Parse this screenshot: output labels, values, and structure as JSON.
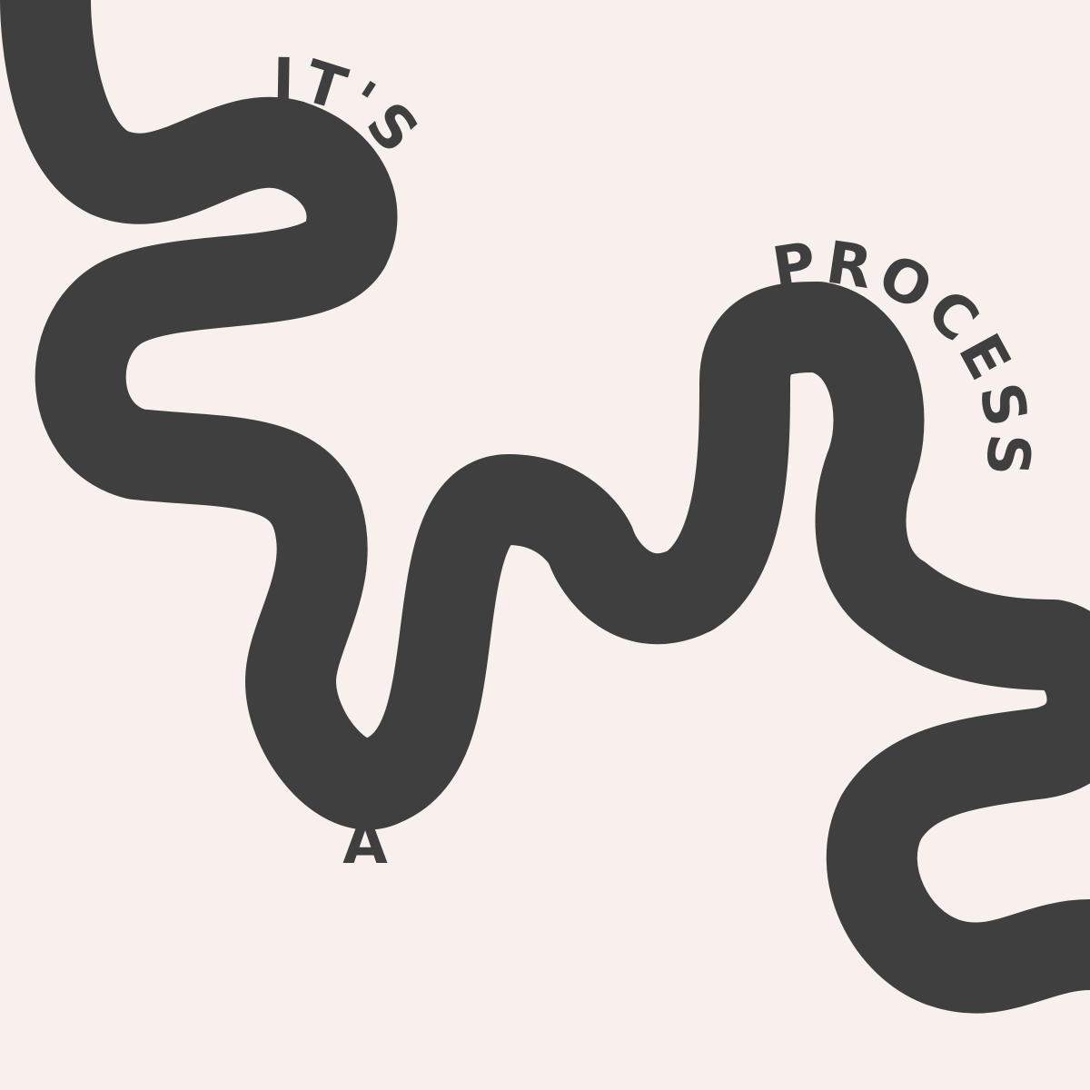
{
  "artwork": {
    "background_color": "#f7f0ed",
    "ink_color": "#3f3f3f",
    "words": {
      "first": "IT'S",
      "second": "A",
      "third": "PROCESS"
    }
  }
}
